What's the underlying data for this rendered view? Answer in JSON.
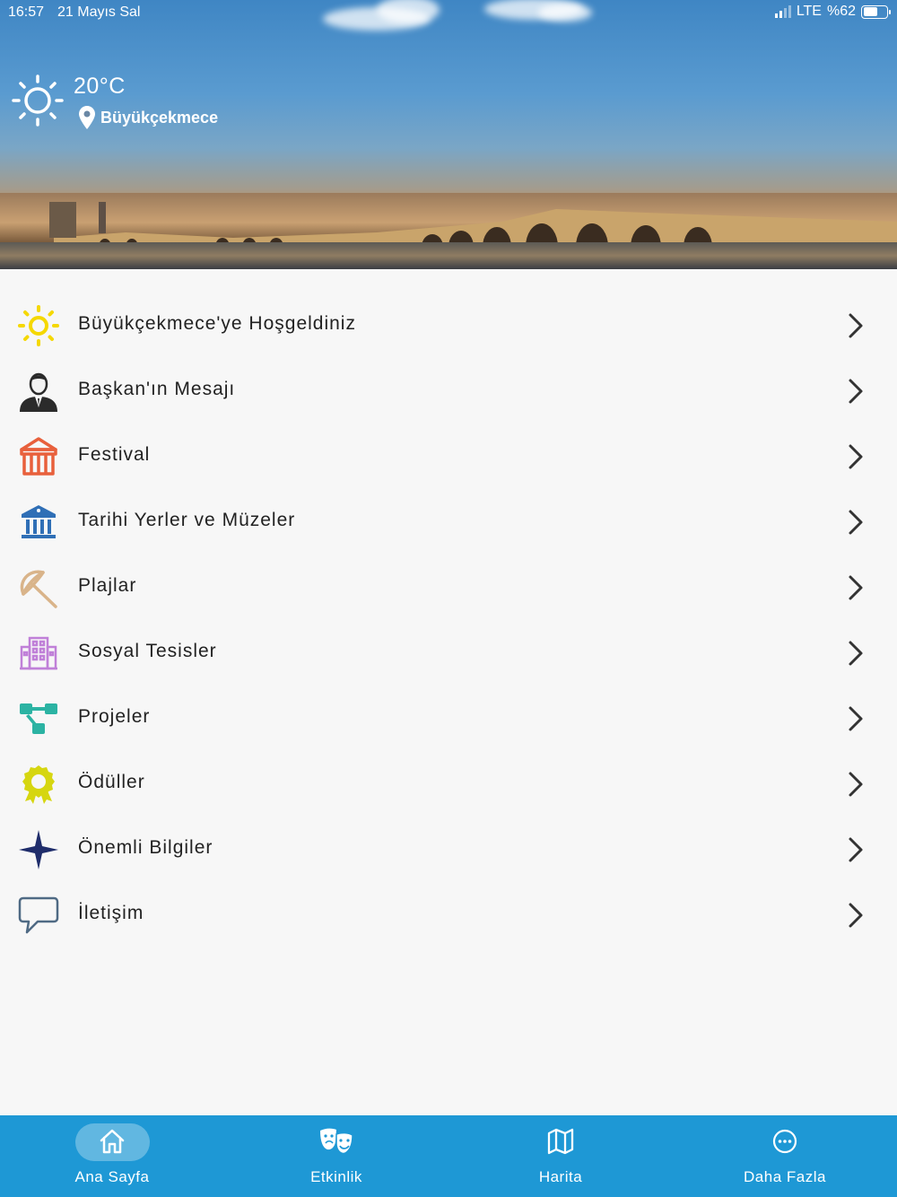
{
  "status_bar": {
    "time": "16:57",
    "date": "21 Mayıs Sal",
    "network": "LTE",
    "battery": "%62",
    "battery_level": 0.62
  },
  "weather": {
    "temperature": "20°C",
    "location": "Büyükçekmece",
    "icon": "sun-icon"
  },
  "menu": [
    {
      "label": "Büyükçekmece'ye Hoşgeldiniz",
      "icon": "sun-icon",
      "color": "#f5d800"
    },
    {
      "label": "Başkan'ın Mesajı",
      "icon": "person-icon",
      "color": "#2b2b2b"
    },
    {
      "label": "Festival",
      "icon": "tent-icon",
      "color": "#e8603c"
    },
    {
      "label": "Tarihi Yerler ve Müzeler",
      "icon": "museum-icon",
      "color": "#2f6fb6"
    },
    {
      "label": "Plajlar",
      "icon": "umbrella-icon",
      "color": "#d9b48a"
    },
    {
      "label": "Sosyal Tesisler",
      "icon": "building-icon",
      "color": "#c080d8"
    },
    {
      "label": "Projeler",
      "icon": "flow-icon",
      "color": "#2bb3a3"
    },
    {
      "label": "Ödüller",
      "icon": "award-icon",
      "color": "#d6d610"
    },
    {
      "label": "Önemli Bilgiler",
      "icon": "star-icon",
      "color": "#1f2d6b"
    },
    {
      "label": "İletişim",
      "icon": "chat-icon",
      "color": "#4f6a84"
    }
  ],
  "tabbar": {
    "accent": "#1e98d5",
    "tabs": [
      {
        "label": "Ana Sayfa",
        "icon": "home-icon",
        "active": true
      },
      {
        "label": "Etkinlik",
        "icon": "theater-masks-icon",
        "active": false
      },
      {
        "label": "Harita",
        "icon": "map-icon",
        "active": false
      },
      {
        "label": "Daha Fazla",
        "icon": "more-icon",
        "active": false
      }
    ]
  }
}
